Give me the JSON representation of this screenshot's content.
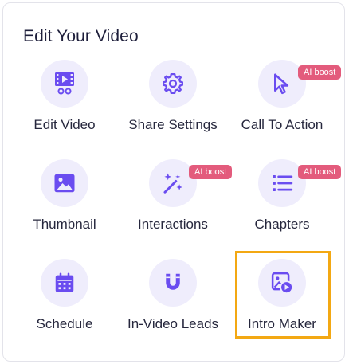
{
  "panel": {
    "title": "Edit Your Video"
  },
  "colors": {
    "accent": "#6a4cf0",
    "icon_background": "#efedfc",
    "badge": "#e35b7c",
    "highlight": "#f3a813"
  },
  "tiles": [
    {
      "label": "Edit Video",
      "icon": "film-edit-icon",
      "badge": ""
    },
    {
      "label": "Share Settings",
      "icon": "gear-icon",
      "badge": ""
    },
    {
      "label": "Call To Action",
      "icon": "cursor-arrow-icon",
      "badge": "AI boost"
    },
    {
      "label": "Thumbnail",
      "icon": "image-icon",
      "badge": ""
    },
    {
      "label": "Interactions",
      "icon": "magic-wand-icon",
      "badge": "AI boost"
    },
    {
      "label": "Chapters",
      "icon": "list-icon",
      "badge": "AI boost"
    },
    {
      "label": "Schedule",
      "icon": "calendar-icon",
      "badge": ""
    },
    {
      "label": "In-Video Leads",
      "icon": "magnet-icon",
      "badge": ""
    },
    {
      "label": "Intro Maker",
      "icon": "video-image-icon",
      "badge": "",
      "selected": true
    }
  ]
}
